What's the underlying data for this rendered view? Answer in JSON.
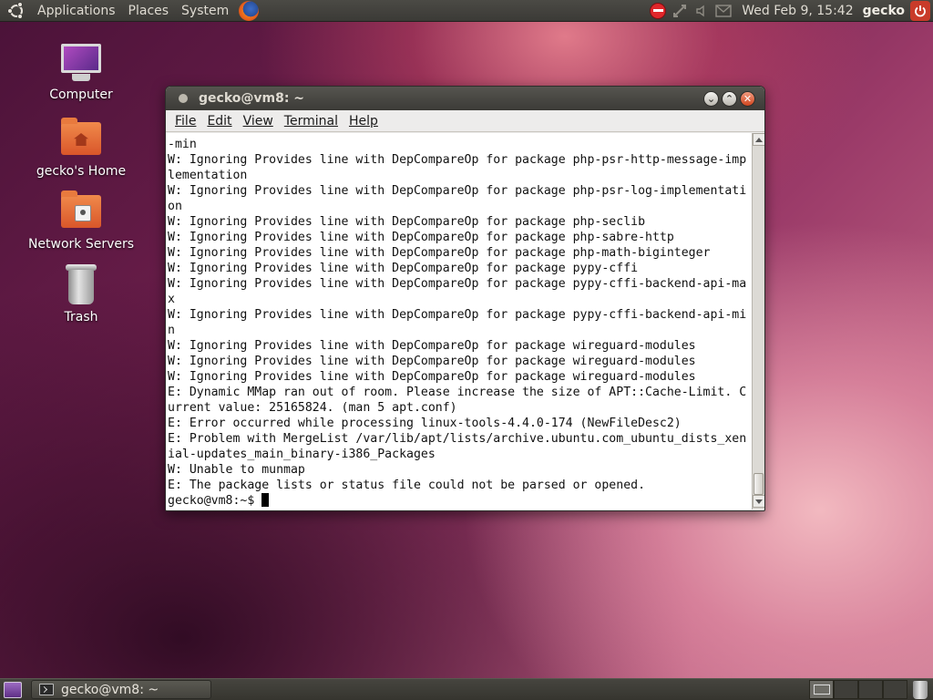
{
  "top_panel": {
    "menus": [
      "Applications",
      "Places",
      "System"
    ],
    "clock": "Wed Feb  9, 15:42",
    "user": "gecko"
  },
  "desktop_icons": [
    {
      "label": "Computer",
      "icon": "computer-icon"
    },
    {
      "label": "gecko's Home",
      "icon": "home-folder-icon"
    },
    {
      "label": "Network Servers",
      "icon": "network-servers-icon"
    },
    {
      "label": "Trash",
      "icon": "trash-icon"
    }
  ],
  "window": {
    "title": "gecko@vm8: ~",
    "menu": [
      "File",
      "Edit",
      "View",
      "Terminal",
      "Help"
    ]
  },
  "terminal": {
    "lines": [
      "-min",
      "W: Ignoring Provides line with DepCompareOp for package php-psr-http-message-imp",
      "lementation",
      "W: Ignoring Provides line with DepCompareOp for package php-psr-log-implementati",
      "on",
      "W: Ignoring Provides line with DepCompareOp for package php-seclib",
      "W: Ignoring Provides line with DepCompareOp for package php-sabre-http",
      "W: Ignoring Provides line with DepCompareOp for package php-math-biginteger",
      "W: Ignoring Provides line with DepCompareOp for package pypy-cffi",
      "W: Ignoring Provides line with DepCompareOp for package pypy-cffi-backend-api-ma",
      "x",
      "W: Ignoring Provides line with DepCompareOp for package pypy-cffi-backend-api-mi",
      "n",
      "W: Ignoring Provides line with DepCompareOp for package wireguard-modules",
      "W: Ignoring Provides line with DepCompareOp for package wireguard-modules",
      "W: Ignoring Provides line with DepCompareOp for package wireguard-modules",
      "E: Dynamic MMap ran out of room. Please increase the size of APT::Cache-Limit. C",
      "urrent value: 25165824. (man 5 apt.conf)",
      "E: Error occurred while processing linux-tools-4.4.0-174 (NewFileDesc2)",
      "E: Problem with MergeList /var/lib/apt/lists/archive.ubuntu.com_ubuntu_dists_xen",
      "ial-updates_main_binary-i386_Packages",
      "W: Unable to munmap",
      "E: The package lists or status file could not be parsed or opened."
    ],
    "prompt": "gecko@vm8:~$ "
  },
  "taskbar": {
    "task_label": "gecko@vm8: ~"
  }
}
